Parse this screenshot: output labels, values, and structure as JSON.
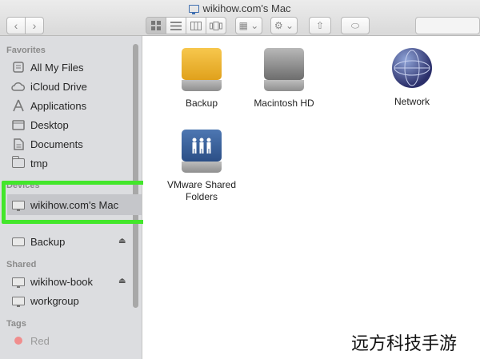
{
  "window": {
    "title": "wikihow.com's Mac"
  },
  "toolbar": {
    "back_glyph": "‹",
    "forward_glyph": "›",
    "view_icons": [
      "icon-view-icon",
      "list-view-icon",
      "column-view-icon",
      "cover-flow-icon"
    ],
    "arrange_glyph": "▦ ⌄",
    "action_glyph": "⚙ ⌄",
    "share_glyph": "⇧",
    "tag_glyph": "⬭"
  },
  "sidebar": {
    "favorites_heading": "Favorites",
    "favorites": [
      {
        "label": "All My Files",
        "icon": "all-files-icon"
      },
      {
        "label": "iCloud Drive",
        "icon": "cloud-icon"
      },
      {
        "label": "Applications",
        "icon": "applications-icon"
      },
      {
        "label": "Desktop",
        "icon": "desktop-icon"
      },
      {
        "label": "Documents",
        "icon": "documents-icon"
      },
      {
        "label": "tmp",
        "icon": "folder-icon"
      }
    ],
    "devices_heading": "Devices",
    "devices": [
      {
        "label": "wikihow.com's Mac",
        "icon": "computer-icon",
        "selected": true
      },
      {
        "label": "Backup",
        "icon": "disk-icon",
        "eject": "⏏"
      }
    ],
    "shared_heading": "Shared",
    "shared": [
      {
        "label": "wikihow-book",
        "icon": "computer-icon",
        "eject": "⏏"
      },
      {
        "label": "workgroup",
        "icon": "computer-icon"
      }
    ],
    "tags_heading": "Tags",
    "tags": [
      {
        "label": "Red",
        "color": "#f08d8d"
      }
    ]
  },
  "main": {
    "items": [
      {
        "label": "Backup",
        "icon": "external-drive-icon"
      },
      {
        "label": "Macintosh HD",
        "icon": "hard-drive-icon"
      },
      {
        "label": "Network",
        "icon": "network-globe-icon"
      },
      {
        "label": "VMware Shared Folders",
        "icon": "shared-folders-drive-icon"
      }
    ]
  },
  "highlight_color": "#43e62b",
  "watermark": "远方科技手游"
}
